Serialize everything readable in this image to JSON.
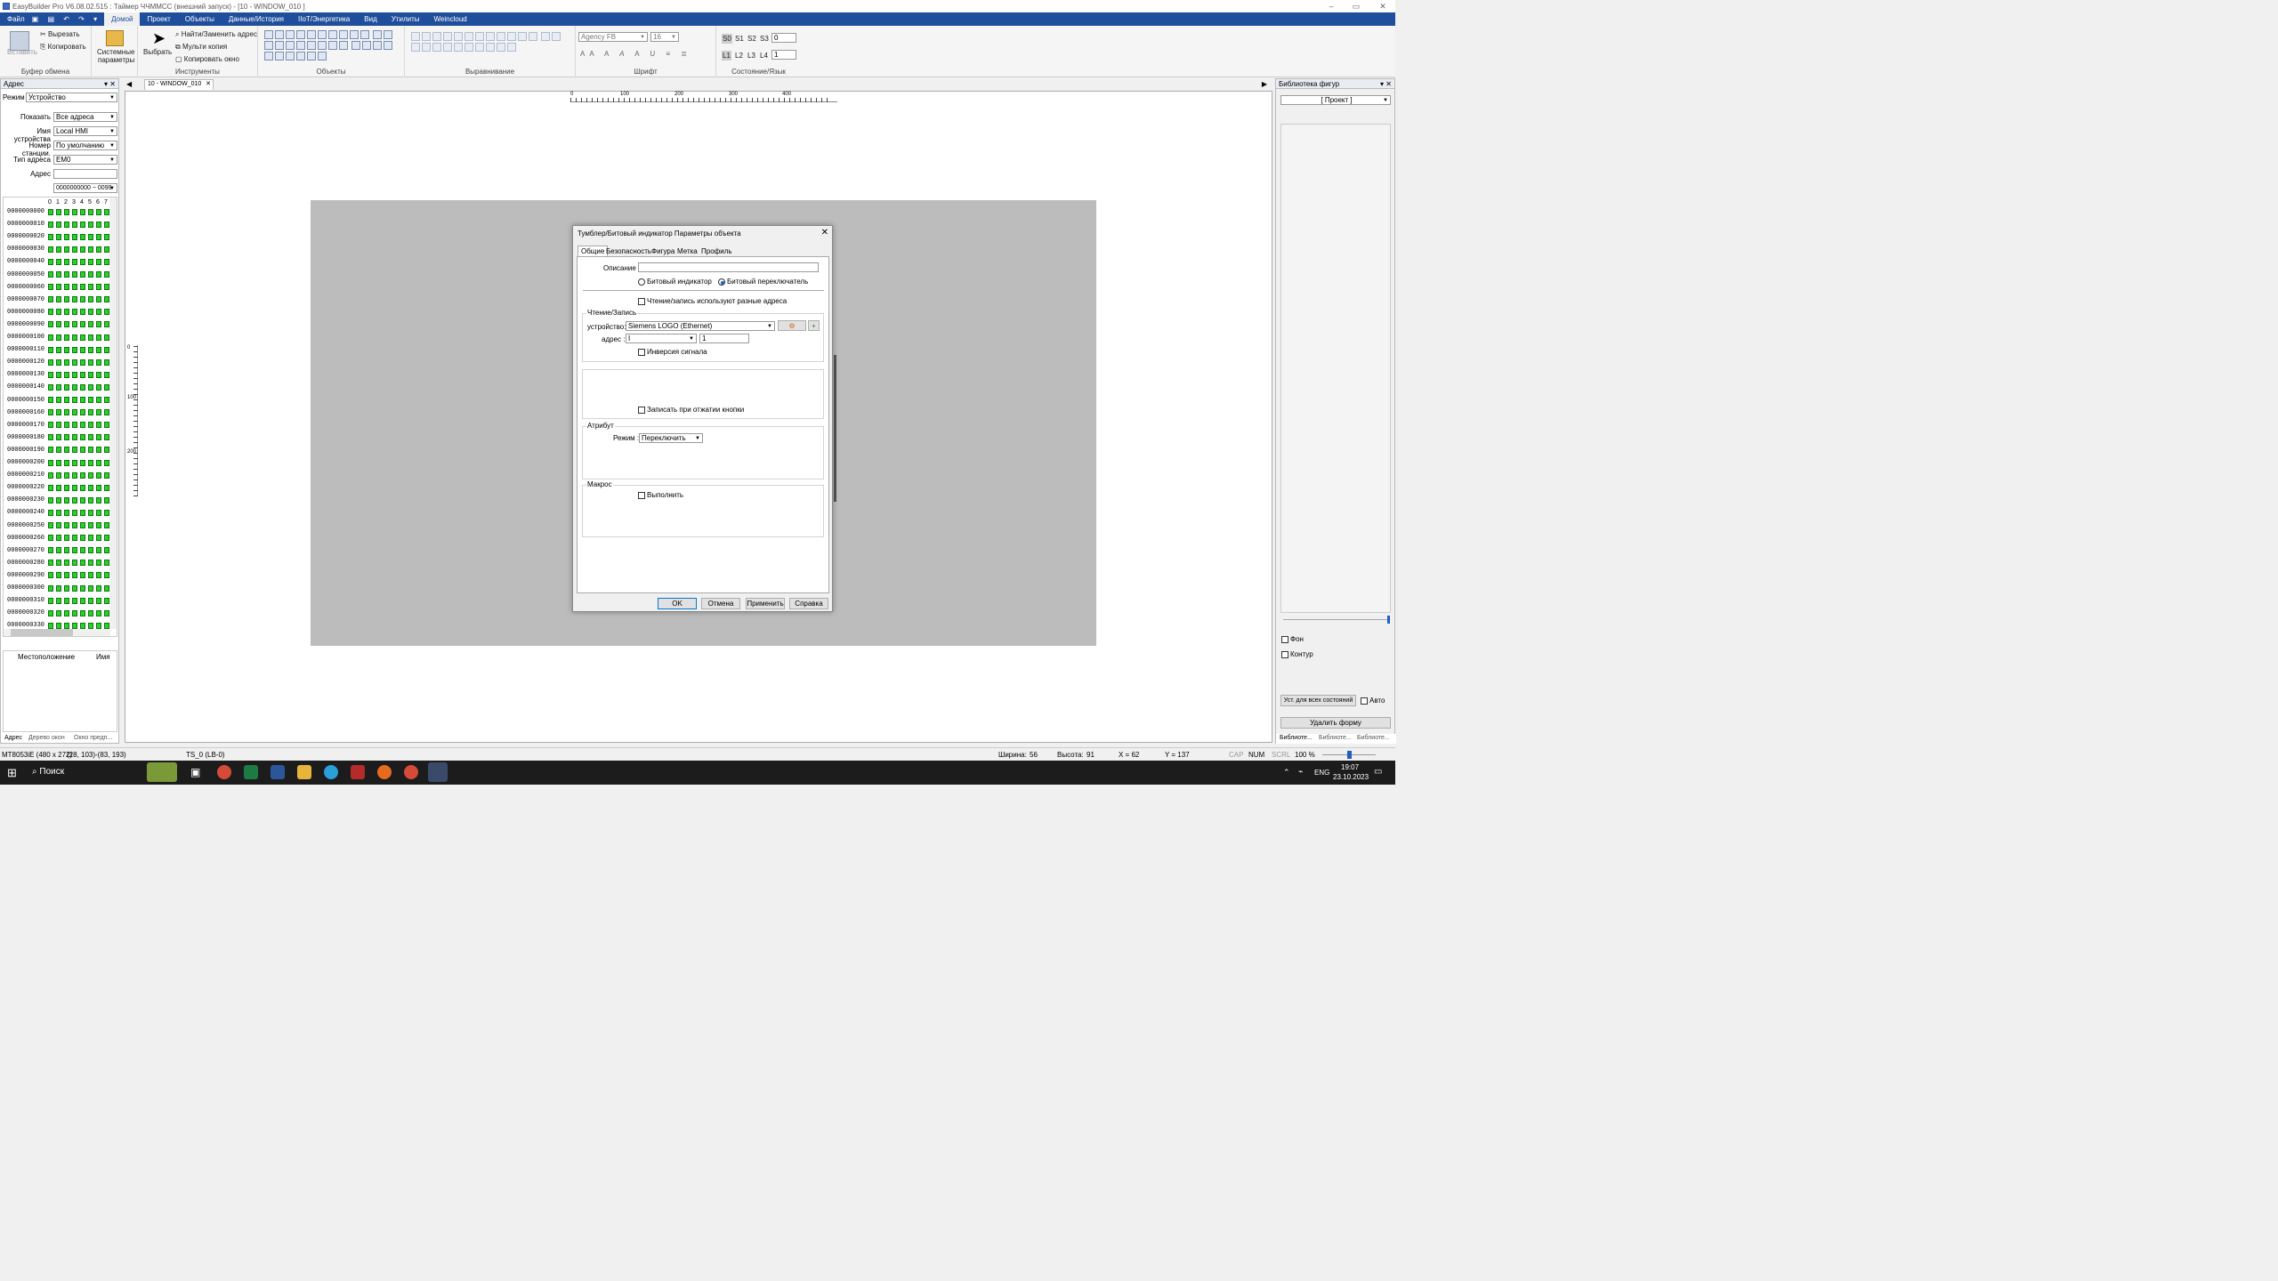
{
  "app": {
    "title": "EasyBuilder Pro V6.08.02.515 : Таймер ЧЧММСС (внешний запуск) - [10 - WINDOW_010 ]"
  },
  "menu": {
    "items": [
      "Файл",
      "Домой",
      "Проект",
      "Объекты",
      "Данные/История",
      "IIoT/Энергетика",
      "Вид",
      "Утилиты",
      "Weincloud"
    ]
  },
  "ribbon": {
    "clipboard": {
      "paste": "Вставить",
      "cut": "Вырезать",
      "copy": "Копировать",
      "label": "Буфер обмена"
    },
    "system": {
      "label1": "Системные",
      "label2": "параметры"
    },
    "tools": {
      "select": "Выбрать",
      "find": "Найти/Заменить адрес",
      "multicopy": "Мульти копия",
      "copywin": "Копировать окно",
      "label": "Инструменты"
    },
    "objects": {
      "label": "Объекты"
    },
    "align": {
      "label": "Выравнивание"
    },
    "font": {
      "name": "Agency FB",
      "size": "16",
      "label": "Шрифт"
    },
    "state": {
      "s": [
        "S0",
        "S1",
        "S2",
        "S3"
      ],
      "l": [
        "L1",
        "L2",
        "L3",
        "L4"
      ],
      "svalue": "0",
      "lvalue": "1",
      "label": "Состояние/Язык"
    }
  },
  "address_panel": {
    "title": "Адрес",
    "mode_label": "Режим",
    "mode_value": "Устройство",
    "show_label": "Показать",
    "show_value": "Все адреса",
    "device_label": "Имя устройства",
    "device_value": "Local HMI",
    "station_label": "Номер станции.",
    "station_value": "По умолчанию",
    "type_label": "Тип адреса",
    "type_value": "EM0",
    "addr_label": "Адрес",
    "addr_value": "",
    "range_value": "0000000000 ~ 0099",
    "bit_headers": [
      "0",
      "1",
      "2",
      "3",
      "4",
      "5",
      "6",
      "7"
    ],
    "rows": [
      "0000000000",
      "0000000010",
      "0000000020",
      "0000000030",
      "0000000040",
      "0000000050",
      "0000000060",
      "0000000070",
      "0000000080",
      "0000000090",
      "0000000100",
      "0000000110",
      "0000000120",
      "0000000130",
      "0000000140",
      "0000000150",
      "0000000160",
      "0000000170",
      "0000000180",
      "0000000190",
      "0000000200",
      "0000000210",
      "0000000220",
      "0000000230",
      "0000000240",
      "0000000250",
      "0000000260",
      "0000000270",
      "0000000280",
      "0000000290",
      "0000000300",
      "0000000310",
      "0000000320",
      "0000000330"
    ],
    "location_col": "Местоположение",
    "name_col": "Имя",
    "tabs": [
      "Адрес",
      "Дерево окон",
      "Окно предп..."
    ]
  },
  "doc_tab": {
    "label": "10 - WINDOW_010"
  },
  "ruler": {
    "top": [
      "0",
      "100",
      "200",
      "300",
      "400"
    ],
    "left": [
      "0",
      "100",
      "200"
    ]
  },
  "dialog": {
    "title": "Тумблер/Битовый индикатор Параметры объекта",
    "tabs": [
      "Общие",
      "Безопасность",
      "Фигура",
      "Метка",
      "Профиль"
    ],
    "description_label": "Описание :",
    "description_value": "",
    "radio_bit_indicator": "Битовый индикатор",
    "radio_bit_switch": "Битовый переключатель",
    "diff_addr": "Чтение/запись используют разные адреса",
    "rw_group": "Чтение/Запись",
    "device_label": "устройство:",
    "device_value": "Siemens LOGO (Ethernet)",
    "address_label": "адрес :",
    "address_type": "I",
    "address_value": "1",
    "invert": "Инверсия сигнала",
    "write_release": "Записать при отжатии кнопки",
    "attr_group": "Атрибут",
    "mode_label": "Режим :",
    "mode_value": "Переключить",
    "macro_group": "Макрос",
    "execute": "Выполнить",
    "buttons": {
      "ok": "OK",
      "cancel": "Отмена",
      "apply": "Применить",
      "help": "Справка"
    }
  },
  "shape_lib": {
    "title": "Библиотека фигур",
    "project": "[ Проект ]",
    "bg": "Фон",
    "outline": "Контур",
    "set_all": "Уст. для всех состояний",
    "auto": "Авто",
    "delete": "Удалить форму",
    "tabs": [
      "Библиоте...",
      "Библиоте...",
      "Библиоте..."
    ]
  },
  "status": {
    "model": "MT8053iE (480 x 272)",
    "coords": "(28, 103)-(83, 193)",
    "obj": "TS_0 (LB-0)",
    "width_label": "Ширина:",
    "width": "56",
    "height_label": "Высота:",
    "height": "91",
    "x": "X = 62",
    "y": "Y = 137",
    "cap": "CAP",
    "num": "NUM",
    "scrl": "SCRL",
    "zoom": "100 %"
  },
  "taskbar": {
    "search": "Поиск",
    "lang": "ENG",
    "time": "19:07",
    "date": "23.10.2023"
  }
}
